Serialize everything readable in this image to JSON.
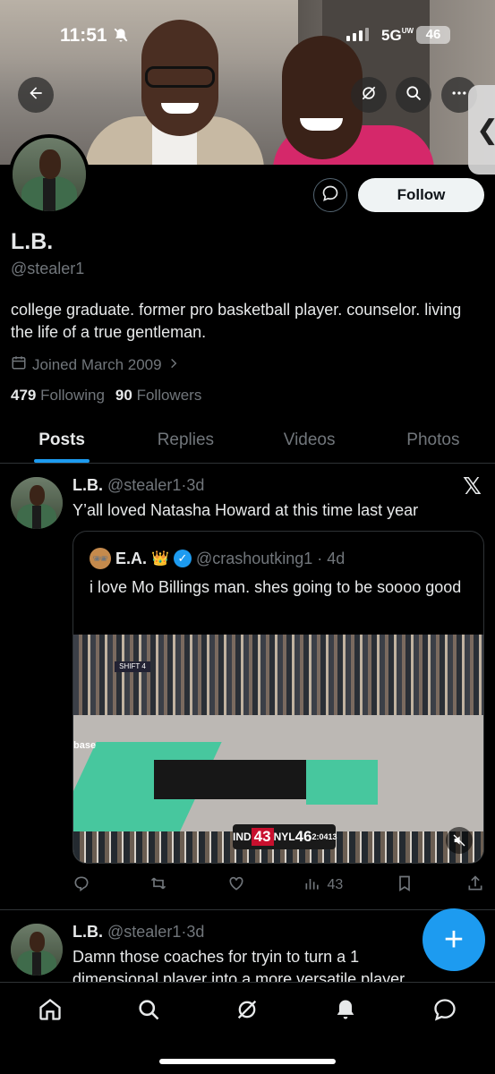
{
  "status_bar": {
    "time": "11:51",
    "network": "5G",
    "network_suffix": "UW",
    "battery": "46"
  },
  "profile": {
    "display_name": "L.B.",
    "handle": "@stealer1",
    "bio": "college graduate. former pro basketball player. counselor. living the life of a true gentleman.",
    "joined": "Joined March 2009",
    "following_count": "479",
    "following_label": "Following",
    "followers_count": "90",
    "followers_label": "Followers",
    "follow_button": "Follow"
  },
  "tabs": [
    {
      "label": "Posts",
      "active": true
    },
    {
      "label": "Replies",
      "active": false
    },
    {
      "label": "Videos",
      "active": false
    },
    {
      "label": "Photos",
      "active": false
    }
  ],
  "posts": [
    {
      "author": "L.B.",
      "handle": "@stealer1",
      "time": "3d",
      "text": "Y’all loved Natasha Howard at this time last year",
      "quote": {
        "author": "E.A.",
        "handle": "@crashoutking1",
        "time": "4d",
        "text": "i love Mo Billings man. shes going to be soooo good",
        "video": {
          "team1": "IND",
          "score1": "43",
          "team2": "NYL",
          "score2": "46",
          "clock": "2:04",
          "shot_clock": "13",
          "ad_text": "SHIFT 4",
          "court_text": "base"
        }
      },
      "stats": {
        "replies": "",
        "reposts": "",
        "likes": "",
        "views": "43"
      }
    },
    {
      "author": "L.B.",
      "handle": "@stealer1",
      "time": "3d",
      "text": "Damn those coaches for tryin to turn a 1 dimensional player into a more versatile player"
    }
  ],
  "icons": {
    "back": "back-arrow-icon",
    "grok": "grok-icon",
    "search": "search-icon",
    "more": "more-icon",
    "message": "message-icon",
    "calendar": "calendar-icon",
    "x_logo": "x-logo-icon",
    "compose": "plus-icon"
  },
  "colors": {
    "accent": "#1d9bf0",
    "background": "#000000",
    "muted": "#71767b",
    "text": "#e7e9ea"
  }
}
